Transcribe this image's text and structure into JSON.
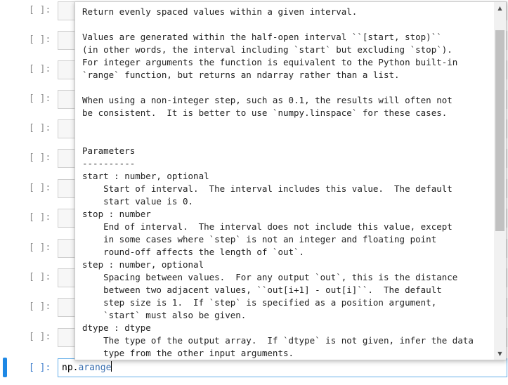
{
  "cells": [
    {
      "prompt": "[ ]:"
    },
    {
      "prompt": "[ ]:"
    },
    {
      "prompt": "[ ]:"
    },
    {
      "prompt": "[ ]:"
    },
    {
      "prompt": "[ ]:"
    },
    {
      "prompt": "[ ]:"
    },
    {
      "prompt": "[ ]:"
    },
    {
      "prompt": "[ ]:"
    },
    {
      "prompt": "[ ]:"
    },
    {
      "prompt": "[ ]:"
    },
    {
      "prompt": "[ ]:"
    },
    {
      "prompt": "[ ]:"
    }
  ],
  "active_cell": {
    "prompt": "[ ]:",
    "code_object": "np",
    "code_dot": ".",
    "code_attr": "arange"
  },
  "tooltip": {
    "docstring": "Return evenly spaced values within a given interval.\n\nValues are generated within the half-open interval ``[start, stop)``\n(in other words, the interval including `start` but excluding `stop`).\nFor integer arguments the function is equivalent to the Python built-in\n`range` function, but returns an ndarray rather than a list.\n\nWhen using a non-integer step, such as 0.1, the results will often not\nbe consistent.  It is better to use `numpy.linspace` for these cases.\n\n\nParameters\n----------\nstart : number, optional\n    Start of interval.  The interval includes this value.  The default\n    start value is 0.\nstop : number\n    End of interval.  The interval does not include this value, except\n    in some cases where `step` is not an integer and floating point\n    round-off affects the length of `out`.\nstep : number, optional\n    Spacing between values.  For any output `out`, this is the distance\n    between two adjacent values, ``out[i+1] - out[i]``.  The default\n    step size is 1.  If `step` is specified as a position argument,\n    `start` must also be given.\ndtype : dtype\n    The type of the output array.  If `dtype` is not given, infer the data\n    type from the other input arguments.",
    "scroll_up_icon": "▲",
    "scroll_down_icon": "▼"
  },
  "colors": {
    "active_accent": "#1e88e5",
    "code_attribute": "#3a6fb0",
    "prompt_gray": "#8d8d8d"
  }
}
